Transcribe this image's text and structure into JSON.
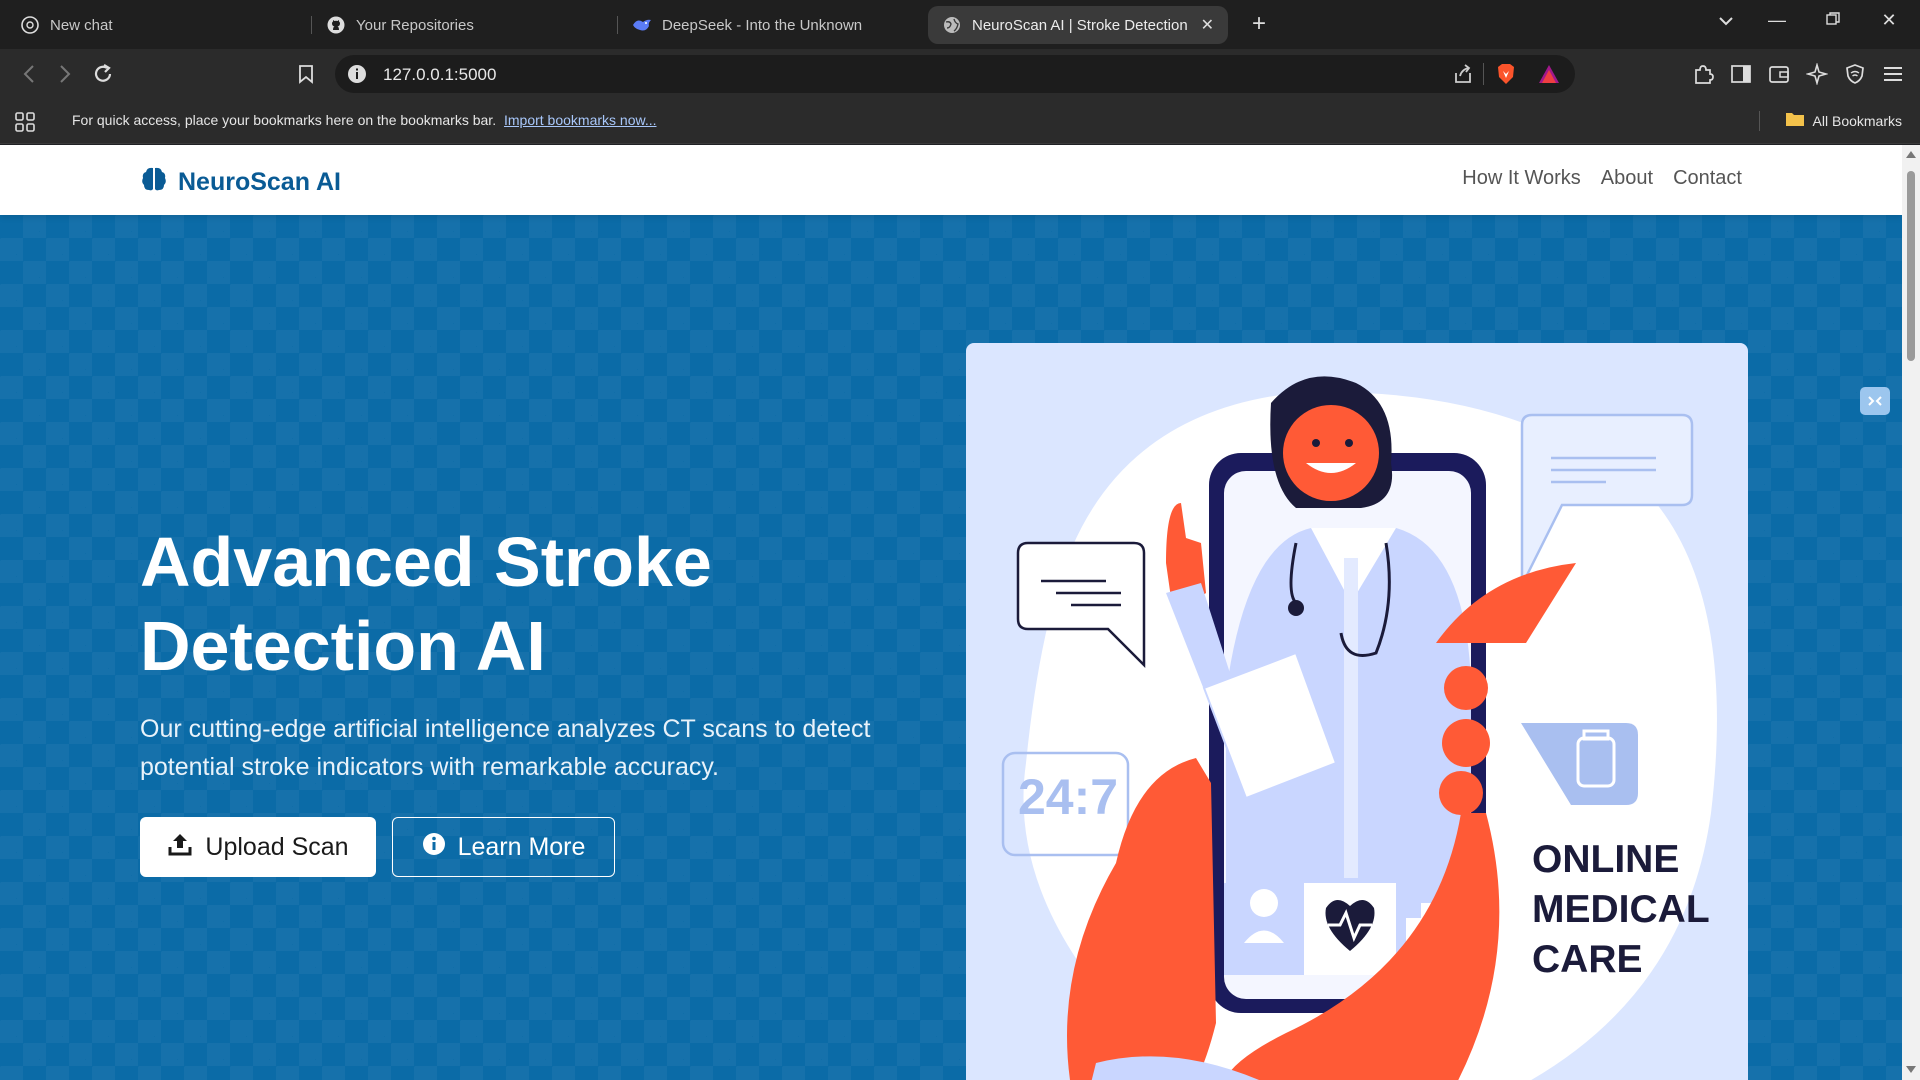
{
  "tabs": [
    {
      "label": "New chat",
      "icon": "chatgpt-icon"
    },
    {
      "label": "Your Repositories",
      "icon": "github-icon"
    },
    {
      "label": "DeepSeek - Into the Unknown",
      "icon": "deepseek-icon"
    },
    {
      "label": "NeuroScan AI | Stroke Detection",
      "icon": "globe-icon",
      "active": true
    }
  ],
  "address": {
    "url": "127.0.0.1:5000"
  },
  "bookmarks": {
    "prompt": "For quick access, place your bookmarks here on the bookmarks bar.",
    "import_link": "Import bookmarks now...",
    "all": "All Bookmarks"
  },
  "site": {
    "brand": "NeuroScan AI",
    "nav": [
      "How It Works",
      "About",
      "Contact"
    ],
    "hero": {
      "title": "Advanced Stroke Detection AI",
      "subtitle": "Our cutting-edge artificial intelligence analyzes CT scans to detect potential stroke indicators with remarkable accuracy.",
      "primary_button": "Upload Scan",
      "secondary_button": "Learn More"
    },
    "illustration": {
      "badge": "24:7",
      "caption_lines": [
        "ONLINE",
        "MEDICAL",
        "CARE"
      ]
    }
  },
  "colors": {
    "brand": "#0a5b95",
    "hero_bg": "#0b6ba7",
    "illus_bg": "#dbe6ff",
    "accent": "#fa5d36"
  }
}
